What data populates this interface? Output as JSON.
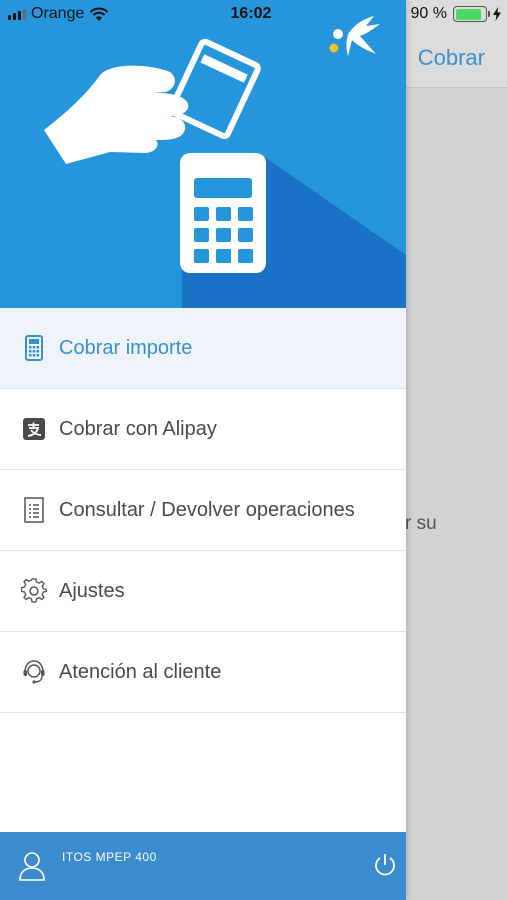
{
  "status_bar": {
    "carrier": "Orange",
    "time": "16:02",
    "battery_percent": "90 %",
    "battery_level": 0.9
  },
  "background": {
    "nav_title": "Cobrar",
    "partial_text": "r su"
  },
  "drawer": {
    "logo_icon": "caixabank-star-icon",
    "hero_icon": "hand-card-pos-terminal-illustration",
    "menu": [
      {
        "label": "Cobrar importe",
        "icon": "pos-terminal-icon",
        "active": true
      },
      {
        "label": "Cobrar con Alipay",
        "icon": "alipay-icon",
        "active": false
      },
      {
        "label": "Consultar / Devolver operaciones",
        "icon": "document-list-icon",
        "active": false
      },
      {
        "label": "Ajustes",
        "icon": "gear-icon",
        "active": false
      },
      {
        "label": "Atención al cliente",
        "icon": "headset-icon",
        "active": false
      }
    ],
    "footer": {
      "device": "ITOS MPEP 400",
      "user_icon": "user-icon",
      "power_icon": "power-icon"
    }
  },
  "colors": {
    "accent": "#2596dc",
    "footer": "#3a8ccf",
    "active_text": "#3a8fd0",
    "battery": "#4cd964"
  }
}
